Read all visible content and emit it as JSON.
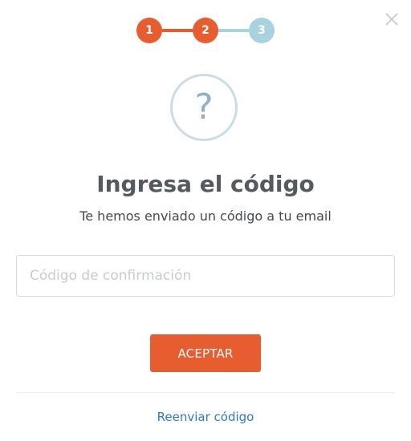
{
  "colors": {
    "accent": "#e85d30",
    "step_inactive": "#a9d2e0",
    "link": "#2b7bc4",
    "title": "#555a5f"
  },
  "close": {
    "icon": "close-icon"
  },
  "stepper": {
    "current_step": 2,
    "steps": [
      {
        "label": "1",
        "state": "completed"
      },
      {
        "label": "2",
        "state": "active"
      },
      {
        "label": "3",
        "state": "pending"
      }
    ]
  },
  "illustration": {
    "icon": "question-icon",
    "glyph": "?"
  },
  "title": "Ingresa el código",
  "subtitle": "Te hemos enviado un código a tu email",
  "form": {
    "code_placeholder": "Código de confirmación",
    "code_value": ""
  },
  "accept_label": "ACEPTAR",
  "resend_label": "Reenviar código"
}
